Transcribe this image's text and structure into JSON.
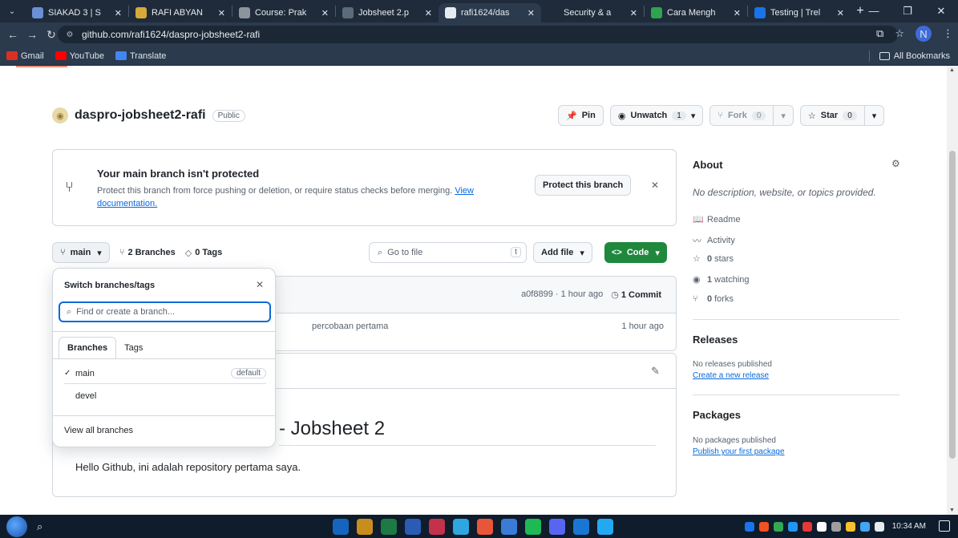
{
  "browser": {
    "tabs": [
      {
        "title": "SIAKAD 3 | S",
        "color": "#6b8fd6"
      },
      {
        "title": "RAFI ABYAN",
        "color": "#d8a93a"
      },
      {
        "title": "Course: Prak",
        "color": "#8c959f"
      },
      {
        "title": "Jobsheet 2.p",
        "color": "#5c6b7a"
      },
      {
        "title": "rafi1624/das",
        "color": "#e6ebf1"
      },
      {
        "title": "Security & a",
        "color": "#1f2b3a"
      },
      {
        "title": "Cara Mengh",
        "color": "#2da44e"
      },
      {
        "title": "Testing | Trel",
        "color": "#1a73e8"
      }
    ],
    "url": "github.com/rafi1624/daspro-jobsheet2-rafi",
    "bookmarks": [
      {
        "label": "Gmail",
        "color": "#d93025"
      },
      {
        "label": "YouTube",
        "color": "#ff0000"
      },
      {
        "label": "Translate",
        "color": "#4285f4"
      }
    ],
    "all_bookmarks": "All Bookmarks"
  },
  "repo": {
    "name": "daspro-jobsheet2-rafi",
    "visibility": "Public",
    "pin": "Pin",
    "unwatch": "Unwatch",
    "unwatch_count": "1",
    "fork": "Fork",
    "fork_count": "0",
    "star": "Star",
    "star_count": "0"
  },
  "protect": {
    "title": "Your main branch isn't protected",
    "desc": "Protect this branch from force pushing or deletion, or require status checks before merging.",
    "link": "View documentation.",
    "button": "Protect this branch"
  },
  "toolbar": {
    "branch": "main",
    "branches": "2 Branches",
    "tags": "0 Tags",
    "goto": "Go to file",
    "goto_key": "t",
    "add_file": "Add file",
    "code": "Code"
  },
  "commit": {
    "hash_time": "a0f8899 · 1 hour ago",
    "commits": "1 Commit",
    "file_msg": "percobaan pertama",
    "file_age": "1 hour ago"
  },
  "readme": {
    "heading": "- Jobsheet 2",
    "body": "Hello Github, ini adalah repository pertama saya."
  },
  "dropdown": {
    "title": "Switch branches/tags",
    "placeholder": "Find or create a branch...",
    "tab_branches": "Branches",
    "tab_tags": "Tags",
    "items": [
      {
        "name": "main",
        "checked": true,
        "badge": "default"
      },
      {
        "name": "devel",
        "checked": false,
        "badge": ""
      }
    ],
    "footer": "View all branches"
  },
  "sidebar": {
    "about": "About",
    "no_desc": "No description, website, or topics provided.",
    "readme": "Readme",
    "activity": "Activity",
    "stars_n": "0",
    "stars": "stars",
    "watching_n": "1",
    "watching": "watching",
    "forks_n": "0",
    "forks": "forks",
    "releases": "Releases",
    "no_releases": "No releases published",
    "create_release": "Create a new release",
    "packages": "Packages",
    "no_packages": "No packages published",
    "publish_package": "Publish your first package"
  },
  "taskbar": {
    "clock": "10:34 AM",
    "apps": [
      "#1565c0",
      "#c98d1e",
      "#1e7a44",
      "#2b5bb5",
      "#c4314b",
      "#2ea6df",
      "#e8563a",
      "#3a7bd5",
      "#1db954",
      "#5865f2",
      "#1976d2",
      "#23a9f2"
    ],
    "tray": [
      "#1a73e8",
      "#f4511e",
      "#34a853",
      "#2196f3",
      "#e53935",
      "#ffffff",
      "#9e9e9e",
      "#fbc02d",
      "#42a5f5",
      "#e6ebf1"
    ]
  }
}
